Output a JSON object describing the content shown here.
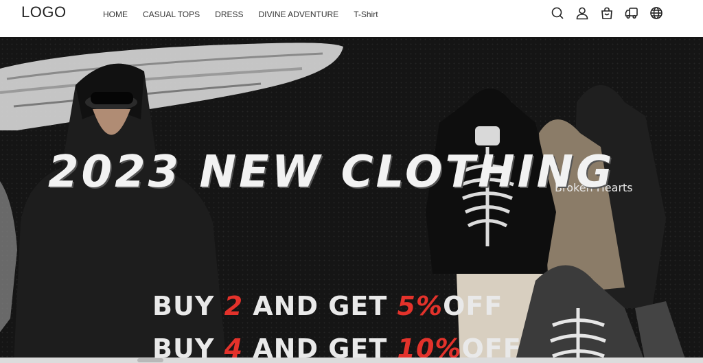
{
  "header": {
    "logo": "LOGO",
    "nav": [
      {
        "label": "HOME"
      },
      {
        "label": "CASUAL TOPS"
      },
      {
        "label": "DRESS"
      },
      {
        "label": "DIVINE ADVENTURE"
      },
      {
        "label": "T-Shirt"
      }
    ],
    "icons": [
      "search-icon",
      "account-icon",
      "cart-icon",
      "shipping-truck-icon",
      "globe-icon"
    ]
  },
  "banner": {
    "headline": "2023 NEW CLOTHING",
    "promo1": {
      "prefix": "BUY ",
      "qty": "2",
      "mid": " AND GET ",
      "pct": "5%",
      "suffix": "OFF"
    },
    "promo2": {
      "prefix": "BUY ",
      "qty": "4",
      "mid": " AND GET ",
      "pct": "10%",
      "suffix": "OFF"
    },
    "hoodie_print": "Broken Hearts",
    "accent_color": "#e3322b"
  }
}
